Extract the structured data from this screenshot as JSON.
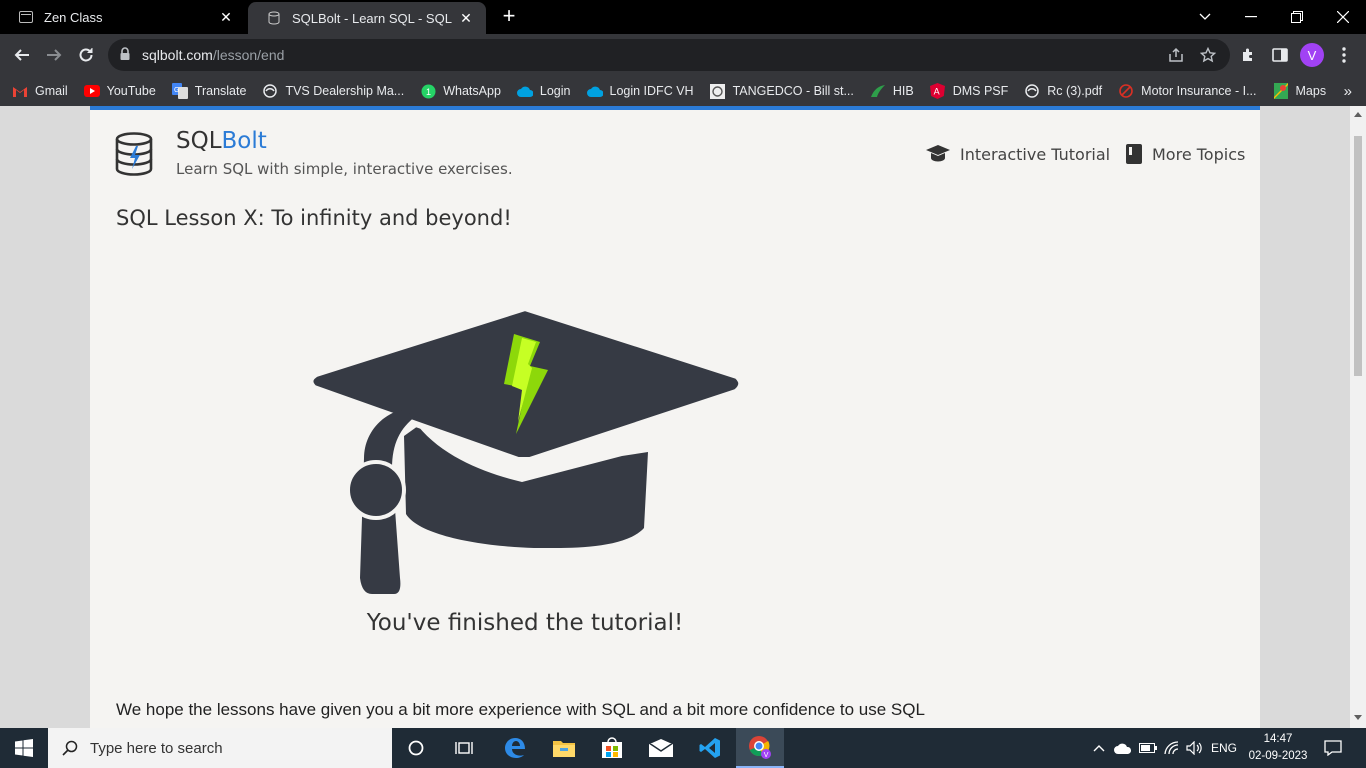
{
  "browser": {
    "tabs": [
      {
        "title": "Zen Class",
        "active": false
      },
      {
        "title": "SQLBolt - Learn SQL - SQL Lesson X: To infinity and beyond!",
        "active": true
      }
    ],
    "url_host": "sqlbolt.com",
    "url_path": "/lesson/end",
    "profile_initial": "V",
    "bookmarks": [
      {
        "label": "Gmail",
        "icon": "gmail-icon"
      },
      {
        "label": "YouTube",
        "icon": "youtube-icon"
      },
      {
        "label": "Translate",
        "icon": "translate-icon"
      },
      {
        "label": "TVS Dealership Ma...",
        "icon": "globe-icon"
      },
      {
        "label": "WhatsApp",
        "icon": "whatsapp-icon"
      },
      {
        "label": "Login",
        "icon": "cloud-icon"
      },
      {
        "label": "Login IDFC VH",
        "icon": "cloud-icon"
      },
      {
        "label": "TANGEDCO - Bill st...",
        "icon": "tangedco-icon"
      },
      {
        "label": "HIB",
        "icon": "hib-icon"
      },
      {
        "label": "DMS PSF",
        "icon": "angular-icon"
      },
      {
        "label": "Rc (3).pdf",
        "icon": "globe-icon"
      },
      {
        "label": "Motor Insurance - I...",
        "icon": "motor-icon"
      },
      {
        "label": "Maps",
        "icon": "maps-icon"
      }
    ],
    "more_bookmarks": "»"
  },
  "site": {
    "brand_sql": "SQL",
    "brand_bolt": "Bolt",
    "tagline": "Learn SQL with simple, interactive exercises.",
    "nav": [
      {
        "label": "Interactive Tutorial",
        "icon": "graduation-cap-icon"
      },
      {
        "label": "More Topics",
        "icon": "book-icon"
      }
    ],
    "lesson_title": "SQL Lesson X: To infinity and beyond!",
    "finished_text": "You've finished the tutorial!",
    "body_text": "We hope the lessons have given you a bit more experience with SQL and a bit more confidence to use SQL",
    "accent_color": "#2b7bd6"
  },
  "taskbar": {
    "search_placeholder": "Type here to search",
    "language": "ENG",
    "time": "14:47",
    "date": "02-09-2023"
  }
}
